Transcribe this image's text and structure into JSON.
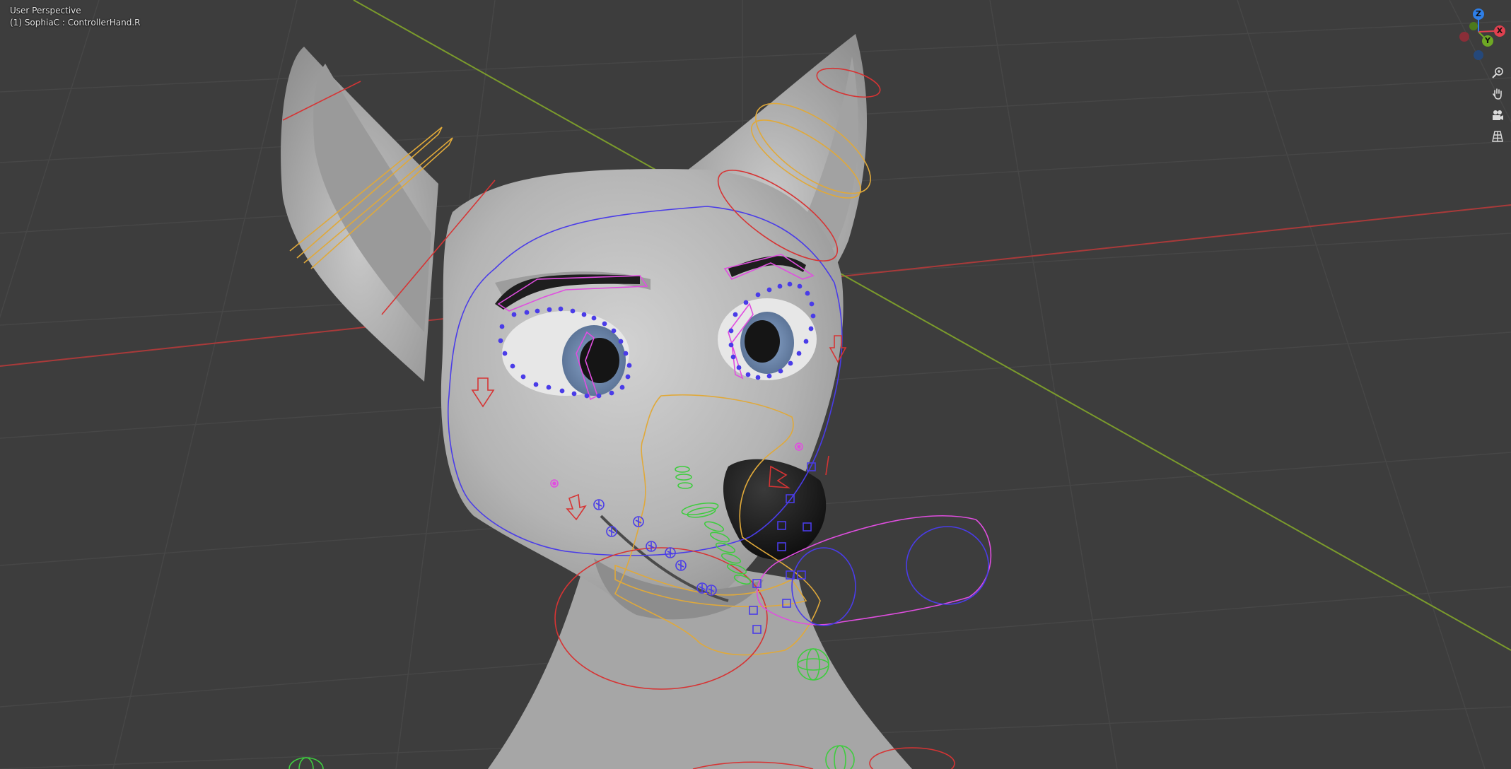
{
  "viewport": {
    "view_name": "User Perspective",
    "active_object": "(1) SophiaC : ControllerHand.R"
  },
  "gizmo": {
    "axes": {
      "z": {
        "label": "Z",
        "color": "#2e7fe8"
      },
      "y": {
        "label": "Y",
        "color": "#6ea824"
      },
      "x": {
        "label": "X",
        "color": "#e0404f"
      }
    }
  },
  "tools": [
    {
      "name": "zoom-icon"
    },
    {
      "name": "hand-pan-icon"
    },
    {
      "name": "camera-icon"
    },
    {
      "name": "perspective-grid-icon"
    }
  ],
  "colors": {
    "background": "#3d3d3d",
    "grid": "#4a4a4a",
    "x_axis": "#a93a3a",
    "y_axis": "#7b9b2c",
    "mesh": "#b8b8b8",
    "bone_yellow": "#e0a93a",
    "bone_red": "#d63434",
    "bone_magenta": "#e04ee0",
    "bone_blue": "#4a3ce8",
    "bone_green": "#3fcc3f"
  }
}
